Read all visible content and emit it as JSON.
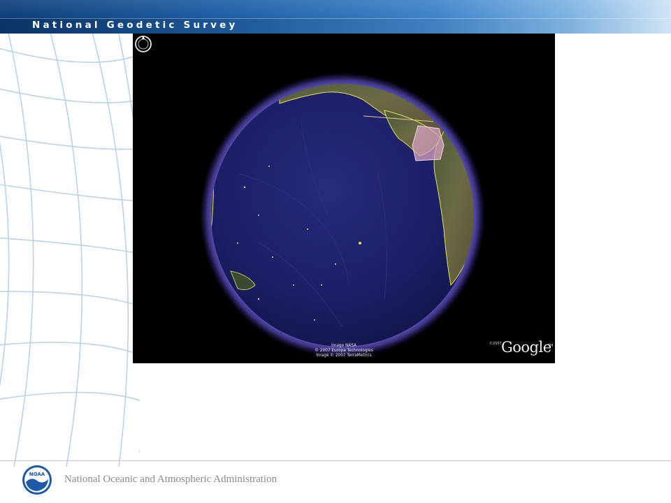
{
  "header": {
    "title": "National Geodetic Survey"
  },
  "map": {
    "attribution_lines": [
      "Image NASA",
      "© 2007 Europa Technologies",
      "Image © 2007 TerraMetrics"
    ],
    "copyright_badge": "©2007",
    "provider": "Google",
    "trademark": "TM",
    "compass_icon": "compass-icon"
  },
  "footer": {
    "logo_text": "NOAA",
    "organization": "National Oceanic and Atmospheric Administration"
  },
  "colors": {
    "banner": "#1d5ea6",
    "ocean": "#1b1f66",
    "atmosphere": "#7d6cf0",
    "coastline": "#e6e05a",
    "highlight_region": "#d7a2c0"
  }
}
